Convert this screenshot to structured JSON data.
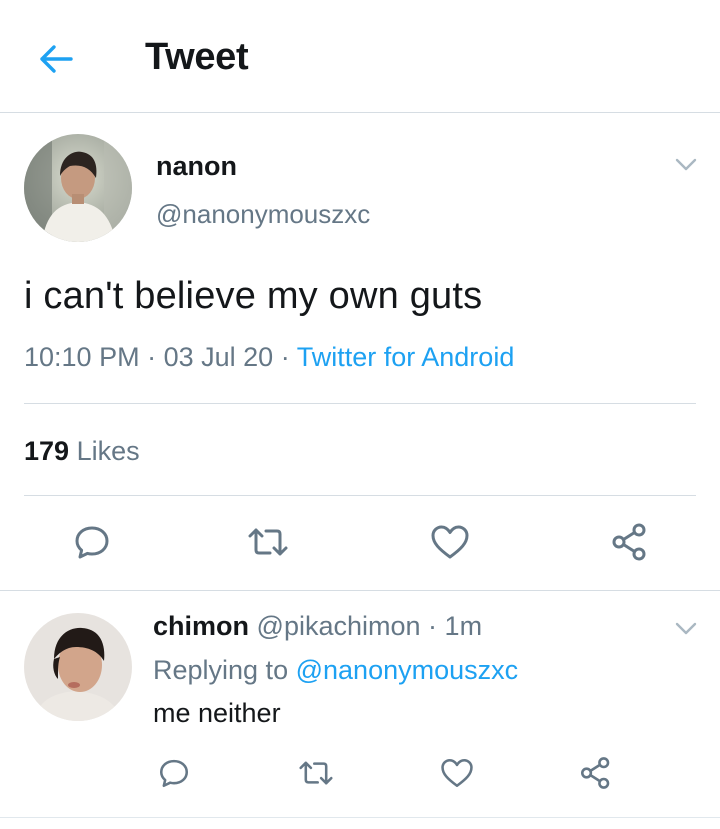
{
  "header": {
    "title": "Tweet",
    "back_icon": "arrow-left-icon"
  },
  "colors": {
    "accent": "#1da1f2",
    "text_primary": "#14171a",
    "text_secondary": "#657786",
    "divider": "#d6dde3",
    "icon_gray": "#657786"
  },
  "main_tweet": {
    "author": {
      "name": "nanon",
      "handle": "@nanonymouszxc"
    },
    "text": "i can't believe my own guts",
    "time": "10:10 PM",
    "dot": "·",
    "date": "03 Jul 20",
    "source": "Twitter for Android",
    "likes_count": "179",
    "likes_label": "Likes",
    "actions": [
      "reply-icon",
      "retweet-icon",
      "like-icon",
      "share-icon"
    ]
  },
  "reply": {
    "author": {
      "name": "chimon",
      "handle": "@pikachimon"
    },
    "separator": "·",
    "time": "1m",
    "replying_prefix": "Replying to",
    "replying_to": "@nanonymouszxc",
    "text": "me neither",
    "actions": [
      "reply-icon",
      "retweet-icon",
      "like-icon",
      "share-icon"
    ]
  }
}
